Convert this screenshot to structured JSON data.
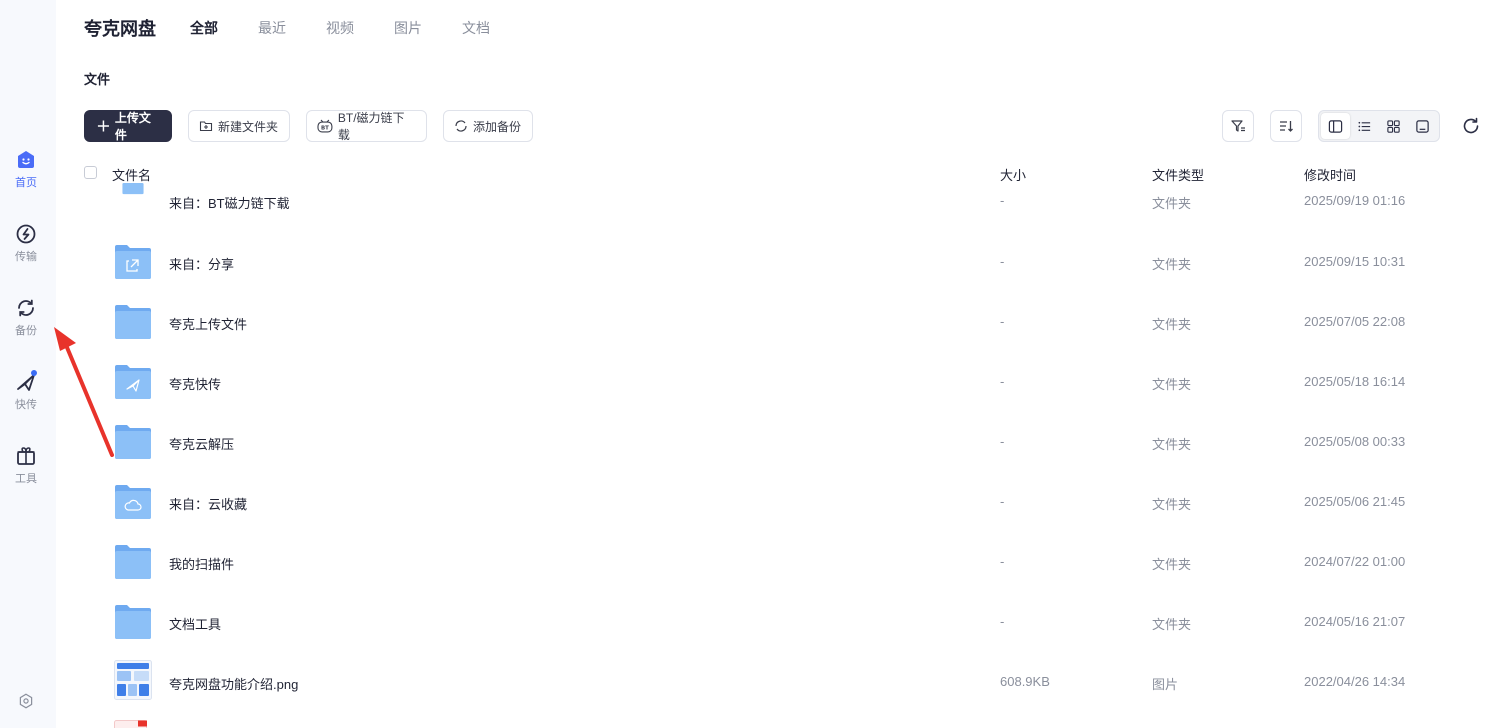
{
  "app": {
    "brand": "夸克网盘",
    "tabs": [
      {
        "label": "全部",
        "active": true
      },
      {
        "label": "最近",
        "active": false
      },
      {
        "label": "视频",
        "active": false
      },
      {
        "label": "图片",
        "active": false
      },
      {
        "label": "文档",
        "active": false
      }
    ]
  },
  "sidebar": {
    "items": [
      {
        "label": "首页",
        "icon": "home-icon",
        "active": true
      },
      {
        "label": "传输",
        "icon": "transfer-icon",
        "active": false
      },
      {
        "label": "备份",
        "icon": "backup-icon",
        "active": false
      },
      {
        "label": "快传",
        "icon": "quick-send-icon",
        "active": false,
        "badge": true
      },
      {
        "label": "工具",
        "icon": "toolbox-icon",
        "active": false
      }
    ],
    "bottom_icon": "settings-icon"
  },
  "breadcrumb": "文件",
  "toolbar": {
    "upload": "上传文件",
    "new_folder": "新建文件夹",
    "bt_download": "BT/磁力链下载",
    "add_backup": "添加备份"
  },
  "table": {
    "headers": {
      "name": "文件名",
      "size": "大小",
      "type": "文件类型",
      "mtime": "修改时间"
    },
    "rows": [
      {
        "name": "来自：BT磁力链下载",
        "size": "-",
        "type": "文件夹",
        "mtime": "2025/09/19 01:16",
        "icon": "folder"
      },
      {
        "name": "来自：分享",
        "size": "-",
        "type": "文件夹",
        "mtime": "2025/09/15 10:31",
        "icon": "folder-share"
      },
      {
        "name": "夸克上传文件",
        "size": "-",
        "type": "文件夹",
        "mtime": "2025/07/05 22:08",
        "icon": "folder"
      },
      {
        "name": "夸克快传",
        "size": "-",
        "type": "文件夹",
        "mtime": "2025/05/18 16:14",
        "icon": "folder-send"
      },
      {
        "name": "夸克云解压",
        "size": "-",
        "type": "文件夹",
        "mtime": "2025/05/08 00:33",
        "icon": "folder"
      },
      {
        "name": "来自：云收藏",
        "size": "-",
        "type": "文件夹",
        "mtime": "2025/05/06 21:45",
        "icon": "folder-cloud"
      },
      {
        "name": "我的扫描件",
        "size": "-",
        "type": "文件夹",
        "mtime": "2024/07/22 01:00",
        "icon": "folder"
      },
      {
        "name": "文档工具",
        "size": "-",
        "type": "文件夹",
        "mtime": "2024/05/16 21:07",
        "icon": "folder"
      },
      {
        "name": "夸克网盘功能介绍.png",
        "size": "608.9KB",
        "type": "图片",
        "mtime": "2022/04/26 14:34",
        "icon": "image-thumb"
      }
    ]
  },
  "colors": {
    "accent": "#4a6cf7",
    "folder": "#7fb6f5",
    "primary_button": "#2c2f45",
    "annotation_arrow": "#e8332b"
  }
}
